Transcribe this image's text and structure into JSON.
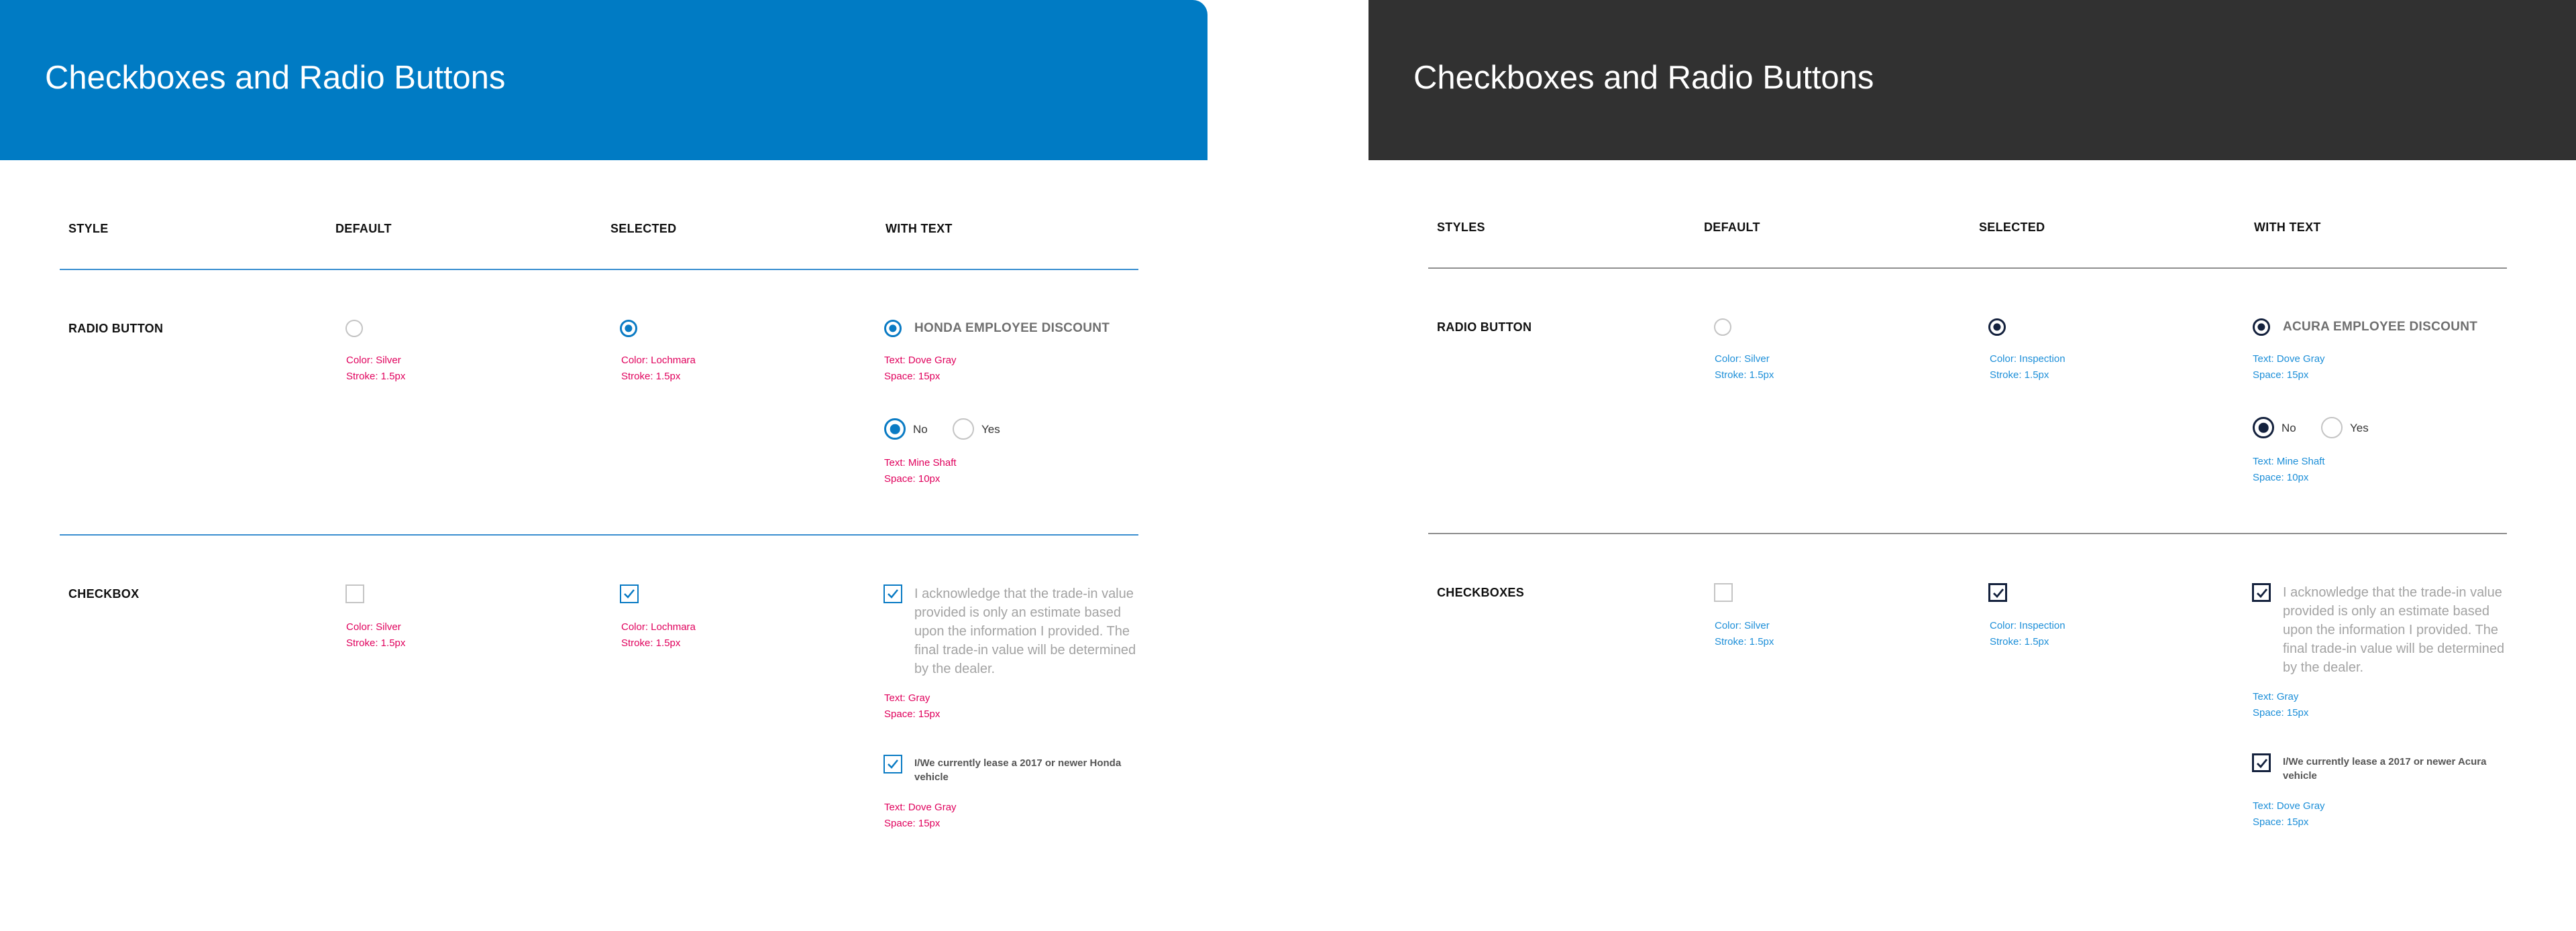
{
  "colors": {
    "honda_header": "#007bc4",
    "acura_header": "#313131",
    "honda_spec_text": "#e0005c",
    "acura_spec_text": "#1b8ed8",
    "lochmara": "#0a7bc4",
    "inspection": "#14213d",
    "silver": "#c4c4c4"
  },
  "honda": {
    "title": "Checkboxes and Radio Buttons",
    "columns": {
      "style": "STYLE",
      "default": "DEFAULT",
      "selected": "SELECTED",
      "with_text": "WITH TEXT"
    },
    "radio": {
      "row_label": "RADIO BUTTON",
      "default_spec": {
        "color": "Color: Silver",
        "stroke": "Stroke: 1.5px"
      },
      "selected_spec": {
        "color": "Color: Lochmara",
        "stroke": "Stroke: 1.5px"
      },
      "with_text_label": "HONDA EMPLOYEE DISCOUNT",
      "with_text_spec": {
        "text": "Text: Dove Gray",
        "space": "Space: 15px"
      },
      "options": [
        "No",
        "Yes"
      ],
      "options_spec": {
        "text": "Text: Mine Shaft",
        "space": "Space: 10px"
      }
    },
    "checkbox": {
      "row_label": "CHECKBOX",
      "default_spec": {
        "color": "Color: Silver",
        "stroke": "Stroke: 1.5px"
      },
      "selected_spec": {
        "color": "Color: Lochmara",
        "stroke": "Stroke: 1.5px"
      },
      "ack_text": "I acknowledge that the trade-in value provided is only an estimate based upon the information I provided. The final trade-in value will be determined by the dealer.",
      "ack_spec": {
        "text": "Text: Gray",
        "space": "Space: 15px"
      },
      "lease_text": "I/We currently lease a 2017 or newer Honda vehicle",
      "lease_spec": {
        "text": "Text: Dove Gray",
        "space": "Space: 15px"
      }
    }
  },
  "acura": {
    "title": "Checkboxes and Radio Buttons",
    "columns": {
      "style": "STYLES",
      "default": "DEFAULT",
      "selected": "SELECTED",
      "with_text": "WITH TEXT"
    },
    "radio": {
      "row_label": "RADIO BUTTON",
      "default_spec": {
        "color": "Color: Silver",
        "stroke": "Stroke: 1.5px"
      },
      "selected_spec": {
        "color": "Color: Inspection",
        "stroke": "Stroke: 1.5px"
      },
      "with_text_label": "ACURA EMPLOYEE DISCOUNT",
      "with_text_spec": {
        "text": "Text: Dove Gray",
        "space": "Space: 15px"
      },
      "options": [
        "No",
        "Yes"
      ],
      "options_spec": {
        "text": "Text: Mine Shaft",
        "space": "Space: 10px"
      }
    },
    "checkbox": {
      "row_label": "CHECKBOXES",
      "default_spec": {
        "color": "Color: Silver",
        "stroke": "Stroke: 1.5px"
      },
      "selected_spec": {
        "color": "Color: Inspection",
        "stroke": "Stroke: 1.5px"
      },
      "ack_text": "I acknowledge that the trade-in value provided is only an estimate based upon the information I provided. The final trade-in value will be determined by the dealer.",
      "ack_spec": {
        "text": "Text: Gray",
        "space": "Space: 15px"
      },
      "lease_text": "I/We currently lease a 2017 or newer Acura vehicle",
      "lease_spec": {
        "text": "Text: Dove Gray",
        "space": "Space: 15px"
      }
    }
  }
}
